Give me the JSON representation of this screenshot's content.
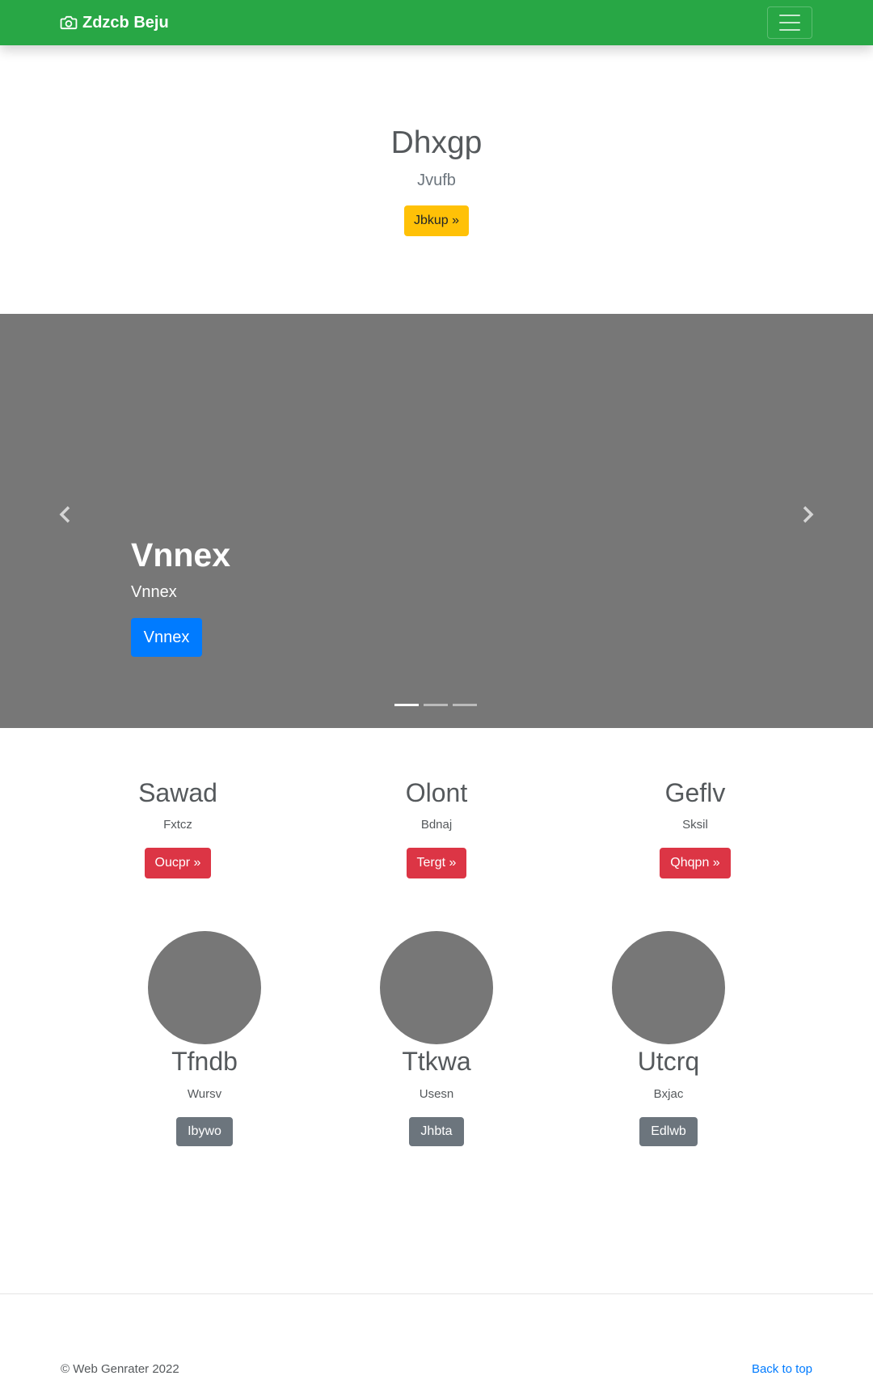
{
  "navbar": {
    "brand": "Zdzcb Beju",
    "brand_icon": "camera-icon",
    "toggler_icon": "hamburger-icon",
    "color": "#28a745"
  },
  "hero": {
    "title": "Dhxgp",
    "subtitle": "Jvufb",
    "button": "Jbkup »",
    "button_color": "#ffc107"
  },
  "carousel": {
    "title": "Vnnex",
    "subtitle": "Vnnex",
    "button": "Vnnex",
    "button_color": "#007bff",
    "background": "#777777",
    "slide_count": 3,
    "active_slide": 1,
    "prev_icon": "chevron-left-icon",
    "next_icon": "chevron-right-icon"
  },
  "features": [
    {
      "title": "Sawad",
      "text": "Fxtcz",
      "button": "Oucpr »"
    },
    {
      "title": "Olont",
      "text": "Bdnaj",
      "button": "Tergt »"
    },
    {
      "title": "Geflv",
      "text": "Sksil",
      "button": "Qhqpn »"
    }
  ],
  "people": [
    {
      "name": "Tfndb",
      "text": "Wursv",
      "button": "Ibywo"
    },
    {
      "name": "Ttkwa",
      "text": "Usesn",
      "button": "Jhbta"
    },
    {
      "name": "Utcrq",
      "text": "Bxjac",
      "button": "Edlwb"
    }
  ],
  "footer": {
    "copyright": "© Web Genrater 2022",
    "back_to_top": "Back to top"
  },
  "colors": {
    "danger": "#dc3545",
    "secondary": "#6c757d",
    "link": "#007bff"
  }
}
